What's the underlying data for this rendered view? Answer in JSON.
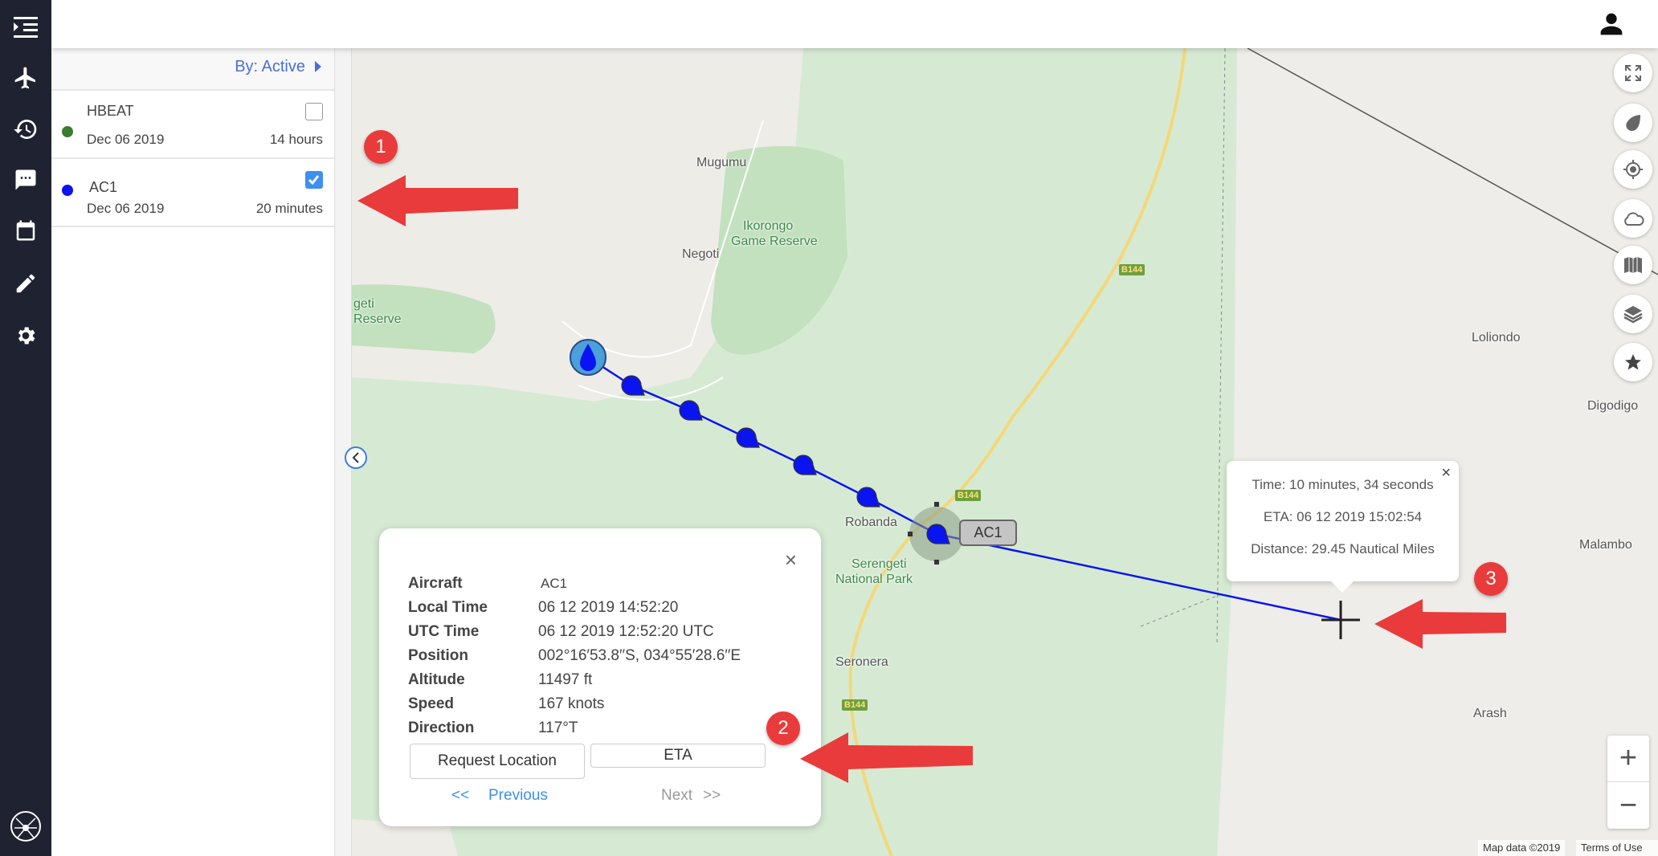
{
  "nav": {
    "items": [
      {
        "icon": "menu-indent-icon"
      },
      {
        "icon": "airplane-icon"
      },
      {
        "icon": "history-icon"
      },
      {
        "icon": "chat-icon"
      },
      {
        "icon": "calendar-icon"
      },
      {
        "icon": "pencil-icon"
      },
      {
        "icon": "gear-icon"
      }
    ],
    "logo_icon": "spider-logo-icon"
  },
  "header": {
    "user_icon": "user-icon"
  },
  "panel": {
    "sort_label": "By: Active",
    "items": [
      {
        "name": "HBEAT",
        "date": "Dec 06 2019",
        "age": "14 hours",
        "color": "#3a7d2c",
        "checked": false
      },
      {
        "name": "AC1",
        "date": "Dec 06 2019",
        "age": "20 minutes",
        "color": "#0a14f0",
        "checked": true
      }
    ]
  },
  "info": {
    "rows": [
      {
        "label": "Aircraft",
        "value": "AC1"
      },
      {
        "label": "Local Time",
        "value": "06 12 2019 14:52:20"
      },
      {
        "label": "UTC Time",
        "value": "06 12 2019 12:52:20 UTC"
      },
      {
        "label": "Position",
        "value": "002°16′53.8′′S, 034°55′28.6′′E"
      },
      {
        "label": "Altitude",
        "value": "11497 ft"
      },
      {
        "label": "Speed",
        "value": "167 knots"
      },
      {
        "label": "Direction",
        "value": "117°T"
      }
    ],
    "request_location": "Request Location",
    "eta_button": "ETA",
    "prev_arrows": "<<",
    "previous": "Previous",
    "next": "Next",
    "next_arrows": ">>",
    "close": "×"
  },
  "eta_popup": {
    "time": "Time: 10 minutes, 34 seconds",
    "eta": "ETA: 06 12 2019 15:02:54",
    "distance": "Distance: 29.45 Nautical Miles",
    "close": "×"
  },
  "map": {
    "aircraft_label": "AC1",
    "track_color": "#0a14f0",
    "labels": {
      "mugumu": "Mugumu",
      "negoti": "Negoti",
      "ikorongo1": "Ikorongo",
      "ikorongo2": "Game Reserve",
      "geti": "geti",
      "reserve": "Reserve",
      "robanda": "Robanda",
      "serengeti1": "Serengeti",
      "serengeti2": "National Park",
      "seronera": "Seronera",
      "loliondo": "Loliondo",
      "digodigo": "Digodigo",
      "malambo": "Malambo",
      "arash": "Arash"
    },
    "road": "B144",
    "zoom_in": "+",
    "zoom_out": "−",
    "attribution": "Map data ©2019",
    "terms": "Terms of Use",
    "controls": [
      "fullscreen-icon",
      "drop-icon",
      "locate-icon",
      "cloud-icon",
      "map-icon",
      "layers-icon",
      "star-icon"
    ]
  },
  "annotations": [
    "1",
    "2",
    "3"
  ],
  "annotation_color": "#e93b3b"
}
